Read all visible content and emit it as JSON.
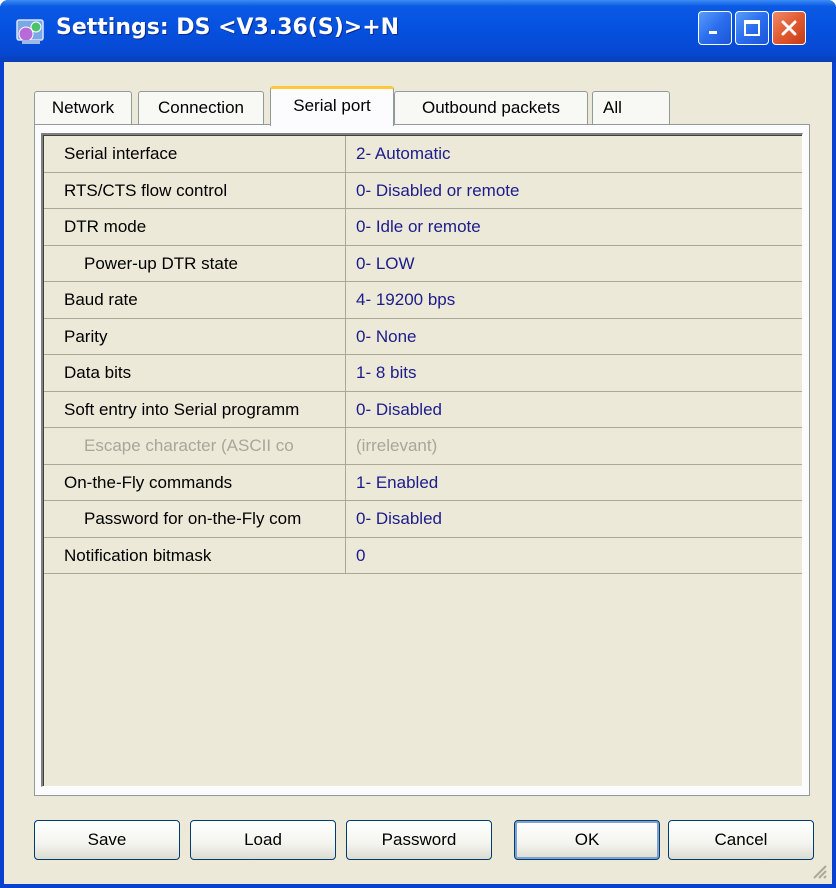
{
  "window": {
    "title": "Settings: DS <V3.36(S)>+N"
  },
  "tabs": [
    {
      "label": "Network",
      "active": false
    },
    {
      "label": "Connection",
      "active": false
    },
    {
      "label": "Serial port",
      "active": true
    },
    {
      "label": "Outbound packets",
      "active": false
    },
    {
      "label": "All",
      "active": false
    }
  ],
  "settings": [
    {
      "name": "Serial interface",
      "value": "2- Automatic"
    },
    {
      "name": "RTS/CTS flow control",
      "value": "0- Disabled or remote"
    },
    {
      "name": "DTR mode",
      "value": "0- Idle or remote"
    },
    {
      "name": "Power-up DTR state",
      "value": "0- LOW"
    },
    {
      "name": "Baud rate",
      "value": "4- 19200 bps"
    },
    {
      "name": "Parity",
      "value": "0- None"
    },
    {
      "name": "Data bits",
      "value": "1- 8 bits"
    },
    {
      "name": "Soft entry into Serial programm",
      "value": "0- Disabled"
    },
    {
      "name": "Escape character (ASCII co",
      "value": "(irrelevant)"
    },
    {
      "name": "On-the-Fly commands",
      "value": "1- Enabled"
    },
    {
      "name": "Password for on-the-Fly com",
      "value": "0- Disabled"
    },
    {
      "name": "Notification bitmask",
      "value": "0"
    }
  ],
  "buttons": {
    "save": "Save",
    "load": "Load",
    "password": "Password",
    "ok": "OK",
    "cancel": "Cancel"
  },
  "colors": {
    "title_bar": "#0551e0",
    "value_text": "#1c1c8c",
    "active_tab_accent": "#ffc83c",
    "disabled_text": "#a7a69a"
  },
  "icons": {
    "app": "settings-app-icon",
    "minimize": "minimize-icon",
    "maximize": "maximize-icon",
    "close": "close-icon",
    "resize": "resize-grip-icon"
  }
}
